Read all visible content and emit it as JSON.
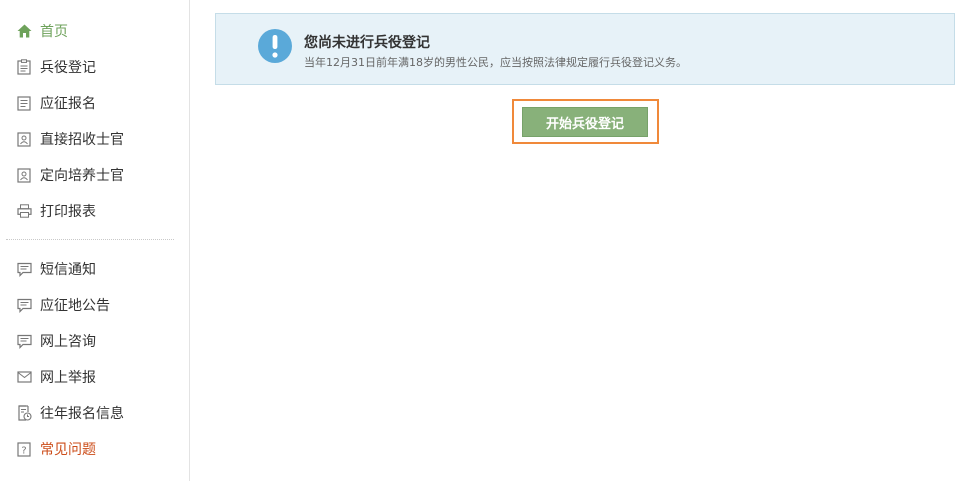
{
  "sidebar": {
    "items": [
      {
        "label": "首页",
        "icon": "home-icon"
      },
      {
        "label": "兵役登记",
        "icon": "clipboard-icon"
      },
      {
        "label": "应征报名",
        "icon": "document-icon"
      },
      {
        "label": "直接招收士官",
        "icon": "id-card-icon"
      },
      {
        "label": "定向培养士官",
        "icon": "id-card-icon"
      },
      {
        "label": "打印报表",
        "icon": "printer-icon"
      },
      {
        "label": "短信通知",
        "icon": "message-icon"
      },
      {
        "label": "应征地公告",
        "icon": "message-icon"
      },
      {
        "label": "网上咨询",
        "icon": "message-icon"
      },
      {
        "label": "网上举报",
        "icon": "envelope-icon"
      },
      {
        "label": "往年报名信息",
        "icon": "history-icon"
      },
      {
        "label": "常见问题",
        "icon": "question-icon"
      }
    ]
  },
  "notice": {
    "title": "您尚未进行兵役登记",
    "description": "当年12月31日前年满18岁的男性公民，应当按照法律规定履行兵役登记义务。"
  },
  "action": {
    "start_label": "开始兵役登记"
  },
  "colors": {
    "active": "#6ea25b",
    "highlight": "#cc4d1a",
    "button": "#88b17a",
    "frame": "#f0893a",
    "notice_bg": "#e7f2f8",
    "info_icon": "#5aa9d9"
  }
}
